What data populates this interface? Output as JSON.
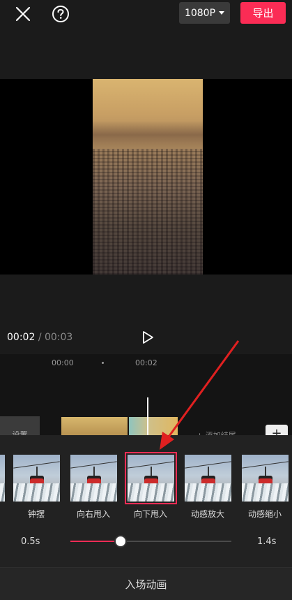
{
  "header": {
    "resolution": "1080P",
    "export_label": "导出"
  },
  "player": {
    "current_time": "00:02",
    "separator": "/",
    "total_time": "00:03"
  },
  "timeline": {
    "ticks": [
      "00:00",
      "00:02"
    ],
    "settings_clip_label": "设置",
    "add_text_label": "+ 添加结尾"
  },
  "animations": {
    "items": [
      {
        "label": "钟摆",
        "selected": false
      },
      {
        "label": "向右甩入",
        "selected": false
      },
      {
        "label": "向下甩入",
        "selected": true
      },
      {
        "label": "动感放大",
        "selected": false
      },
      {
        "label": "动感缩小",
        "selected": false
      }
    ],
    "accent_color": "#fb2c55"
  },
  "duration": {
    "min_label": "0.5s",
    "max_label": "1.4s",
    "value_fraction": 0.31
  },
  "footer": {
    "title": "入场动画"
  },
  "icons": [
    "close-icon",
    "help-icon",
    "caret-down-icon",
    "play-icon",
    "plus-icon",
    "arrow-annotation"
  ]
}
